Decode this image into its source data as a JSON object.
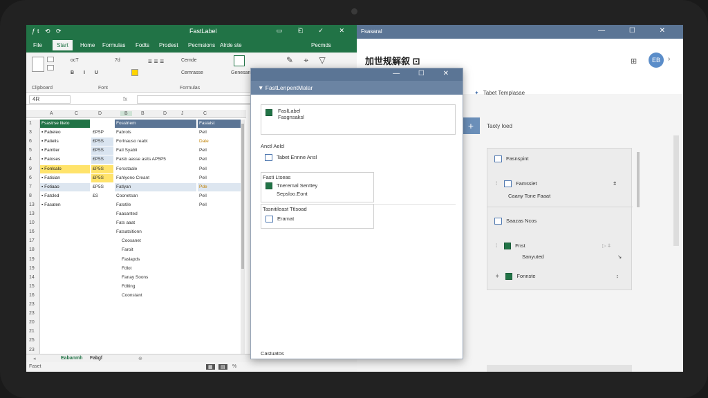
{
  "excel": {
    "title": "FastLabel",
    "quick_access": "ƒt ⟲ ⟳",
    "window_controls": "▭ ⎗ ✓ ✕",
    "tabs": [
      "File",
      "Start",
      "Home",
      "Formulas",
      "Fodts",
      "Prodest",
      "Pecmsions",
      "Alrde ste"
    ],
    "search_tab": "Pecmds",
    "ribbon_groups": [
      "Clipboard",
      "Font",
      "Formulas"
    ],
    "font_name": "ocT",
    "font_size": "7d",
    "style_labels": [
      "Cemde",
      "Cemrasse",
      "Genesan"
    ],
    "name_box": "4R",
    "columns": [
      "A",
      "C",
      "D",
      "B",
      "B",
      "D",
      "J",
      "C"
    ],
    "rows": [
      "1",
      "3",
      "6",
      "5",
      "4",
      "9",
      "6",
      "7",
      "8",
      "13",
      "13",
      "10",
      "16",
      "17",
      "18",
      "19",
      "19",
      "14",
      "15",
      "16",
      "23",
      "23",
      "20",
      "21",
      "25",
      "23"
    ],
    "col_a_header": "Fsastrse liteto",
    "col_a_items": [
      "Fabeleo",
      "Fatielis",
      "Famtler",
      "Fatoses",
      "Fonlsalo",
      "Fatisian",
      "Fotiaao",
      "Fatcled",
      "Fasaten"
    ],
    "col_c_values": [
      "£P5P",
      "£P5S",
      "£P5S",
      "£P5S",
      "£P5S",
      "£P5S",
      "£P5S",
      "£S"
    ],
    "col_b_header": "Fosstriem",
    "col_b_items": [
      "Fabrols",
      "Forlnauso reabt",
      "Fatl Syabli",
      "Falsb aasse aslts AP5P5",
      "Forsstaale",
      "Fahlyono Creant",
      "Fatlyan",
      "Coonetsan",
      "Fatotile",
      "Faasanted",
      "Fats aaat",
      "Fatsatsitionn",
      "Coosanet",
      "Faroit",
      "Faslapds",
      "Fdlot",
      "Fanay Soons",
      "Fdlting",
      "Coonstant"
    ],
    "col_d_header": "Faslaist",
    "col_d_items": [
      "Pell",
      "Date",
      "Pell",
      "Pell",
      "Pell",
      "Pell",
      "Pde",
      "Pell",
      "Pell"
    ],
    "sheet_tabs": [
      "Eabanmh",
      "Fabgf"
    ],
    "status_left": "Faset",
    "status_zoom": "%"
  },
  "right": {
    "title": "Fsasaral",
    "window_controls": "— ☐ ✕",
    "heading": "加世规解叙 ⊡",
    "avatar": "EB",
    "template_link": "Tabet Templasae",
    "tasks_label": "Taoty Ioed",
    "card": {
      "section1": "Fasnspint",
      "item1": "Famsslet",
      "item1_sub": "Caany Tone Faaat",
      "section2": "Saazas Ncos",
      "item2": "Fnst",
      "item2_sub": "Sanyuted",
      "item3": "Fonnste"
    }
  },
  "dialog": {
    "title": "FastLenpentMalar",
    "controls": "— ☐ ✕",
    "box1_title": "FaslLabel",
    "box1_sub": "Fasgnsaksl",
    "section_label": "Anctl Aelcl",
    "task_item": "Tabet Ennne Ansl",
    "box2_header": "Fasti Ltseas",
    "box2_item": "Tneremal Senttey",
    "box2_sub": "Sepsloo.Eont",
    "box3_header": "Tasnitileast Ttlsoad",
    "box3_item": "Eramat",
    "footer": "Castuatos"
  }
}
